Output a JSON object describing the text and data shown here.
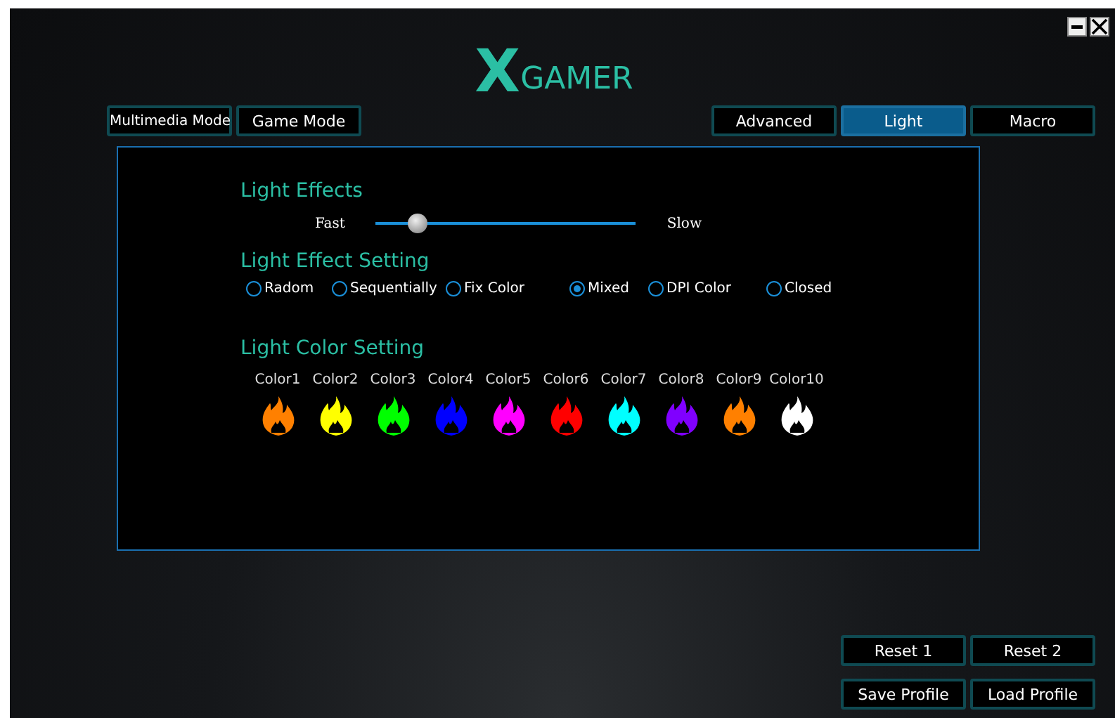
{
  "logo": {
    "mark": "X",
    "text": "GAMER"
  },
  "modes": [
    {
      "label": "Multimedia Mode",
      "selected": false
    },
    {
      "label": "Game Mode",
      "selected": false
    }
  ],
  "tabs": [
    {
      "label": "Advanced",
      "selected": false
    },
    {
      "label": "Light",
      "selected": true
    },
    {
      "label": "Macro",
      "selected": false
    }
  ],
  "light_effects": {
    "title": "Light Effects",
    "min_label": "Fast",
    "max_label": "Slow",
    "level": 0.13
  },
  "effect_setting": {
    "title": "Light Effect Setting",
    "options": [
      {
        "label": "Radom",
        "selected": false
      },
      {
        "label": "Sequentially",
        "selected": false
      },
      {
        "label": "Fix Color",
        "selected": false
      },
      {
        "label": "Mixed",
        "selected": true
      },
      {
        "label": "DPI Color",
        "selected": false
      },
      {
        "label": "Closed",
        "selected": false
      }
    ]
  },
  "color_setting": {
    "title": "Light Color Setting",
    "colors": [
      {
        "label": "Color1",
        "color": "#ff8000"
      },
      {
        "label": "Color2",
        "color": "#ffff00"
      },
      {
        "label": "Color3",
        "color": "#00ff00"
      },
      {
        "label": "Color4",
        "color": "#0000ff"
      },
      {
        "label": "Color5",
        "color": "#ff00ff"
      },
      {
        "label": "Color6",
        "color": "#ff0000"
      },
      {
        "label": "Color7",
        "color": "#00ffff"
      },
      {
        "label": "Color8",
        "color": "#8000ff"
      },
      {
        "label": "Color9",
        "color": "#ff8000"
      },
      {
        "label": "Color10",
        "color": "#ffffff"
      }
    ]
  },
  "bottom_buttons": [
    "Reset 1",
    "Reset 2",
    "Save Profile",
    "Load Profile"
  ]
}
